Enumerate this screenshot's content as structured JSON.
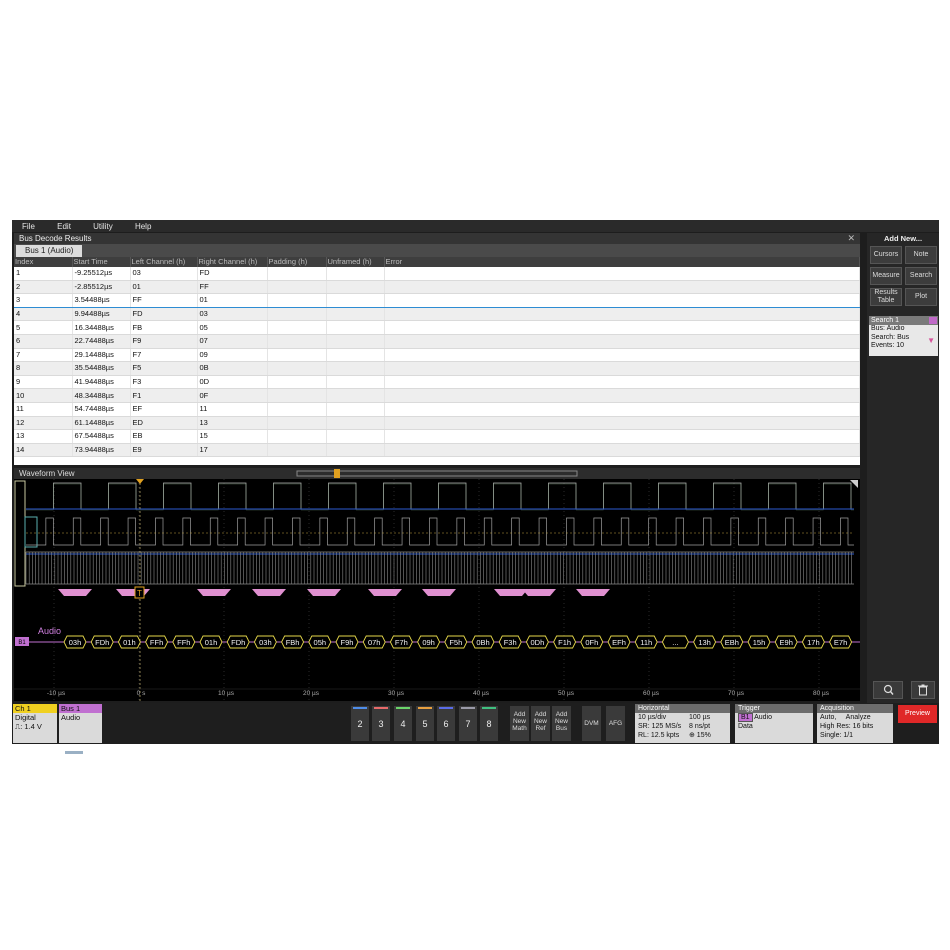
{
  "menu": [
    "File",
    "Edit",
    "Utility",
    "Help"
  ],
  "results": {
    "title": "Bus Decode Results",
    "tab": "Bus 1 (Audio)",
    "columns": [
      "Index",
      "Start Time",
      "Left Channel (h)",
      "Right Channel (h)",
      "Padding (h)",
      "Unframed (h)",
      "Error"
    ],
    "rows": [
      [
        "1",
        "-9.25512µs",
        "03",
        "FD"
      ],
      [
        "2",
        "-2.85512µs",
        "01",
        "FF"
      ],
      [
        "3",
        "3.54488µs",
        "FF",
        "01"
      ],
      [
        "4",
        "9.94488µs",
        "FD",
        "03"
      ],
      [
        "5",
        "16.34488µs",
        "FB",
        "05"
      ],
      [
        "6",
        "22.74488µs",
        "F9",
        "07"
      ],
      [
        "7",
        "29.14488µs",
        "F7",
        "09"
      ],
      [
        "8",
        "35.54488µs",
        "F5",
        "0B"
      ],
      [
        "9",
        "41.94488µs",
        "F3",
        "0D"
      ],
      [
        "10",
        "48.34488µs",
        "F1",
        "0F"
      ],
      [
        "11",
        "54.74488µs",
        "EF",
        "11"
      ],
      [
        "12",
        "61.14488µs",
        "ED",
        "13"
      ],
      [
        "13",
        "67.54488µs",
        "EB",
        "15"
      ],
      [
        "14",
        "73.94488µs",
        "E9",
        "17"
      ]
    ],
    "selected_row": "3"
  },
  "waveform": {
    "title": "Waveform View",
    "bus_label": "Audio",
    "bus_tag": "B1",
    "trigger_marker": "T",
    "packets": [
      "03h",
      "FDh",
      "01h",
      "FFh",
      "FFh",
      "01h",
      "FDh",
      "03h",
      "FBh",
      "05h",
      "F9h",
      "07h",
      "F7h",
      "09h",
      "F5h",
      "0Bh",
      "F3h",
      "0Dh",
      "F1h",
      "0Fh",
      "EFh",
      "11h",
      "...",
      "13h",
      "EBh",
      "15h",
      "E9h",
      "17h",
      "E7h"
    ],
    "time_labels": [
      "-10 µs",
      "0 s",
      "10 µs",
      "20 µs",
      "30 µs",
      "40 µs",
      "50 µs",
      "60 µs",
      "70 µs",
      "80 µs"
    ]
  },
  "side": {
    "add_new": "Add New...",
    "buttons": [
      "Cursors",
      "Note",
      "Measure",
      "Search",
      "Results Table",
      "Plot"
    ],
    "search": {
      "title": "Search 1",
      "lines": [
        "Bus: Audio",
        "Search: Bus",
        "Events: 10"
      ]
    }
  },
  "bottom": {
    "ch1": {
      "title": "Ch 1",
      "line1": "Digital",
      "line2": "⎍: 1.4 V"
    },
    "bus1": {
      "title": "Bus 1",
      "line1": "Audio"
    },
    "channels": [
      {
        "num": "2",
        "color": "#4f8de8"
      },
      {
        "num": "3",
        "color": "#e86a6a"
      },
      {
        "num": "4",
        "color": "#6ad46a"
      },
      {
        "num": "5",
        "color": "#e8a040"
      },
      {
        "num": "6",
        "color": "#5a6ce8"
      },
      {
        "num": "7",
        "color": "#9a9aa8"
      },
      {
        "num": "8",
        "color": "#40c080"
      }
    ],
    "math_buttons": [
      [
        "Add",
        "New",
        "Math"
      ],
      [
        "Add",
        "New",
        "Ref"
      ],
      [
        "Add",
        "New",
        "Bus"
      ]
    ],
    "dvm": "DVM",
    "afg": "AFG",
    "horizontal": {
      "title": "Horizontal",
      "scale": "10 µs/div",
      "length": "100 µs",
      "sr": "SR: 125 MS/s",
      "pt": "8 ns/pt",
      "rl": "RL: 12.5 kpts",
      "pos": "⊕ 15%"
    },
    "trigger": {
      "title": "Trigger",
      "source": "B1",
      "type": "Audio",
      "mode": "Data"
    },
    "acquisition": {
      "title": "Acquisition",
      "line1": "Auto,     Analyze",
      "line2": "High Res: 16 bits",
      "line3": "Single: 1/1"
    },
    "preview": "Preview"
  }
}
